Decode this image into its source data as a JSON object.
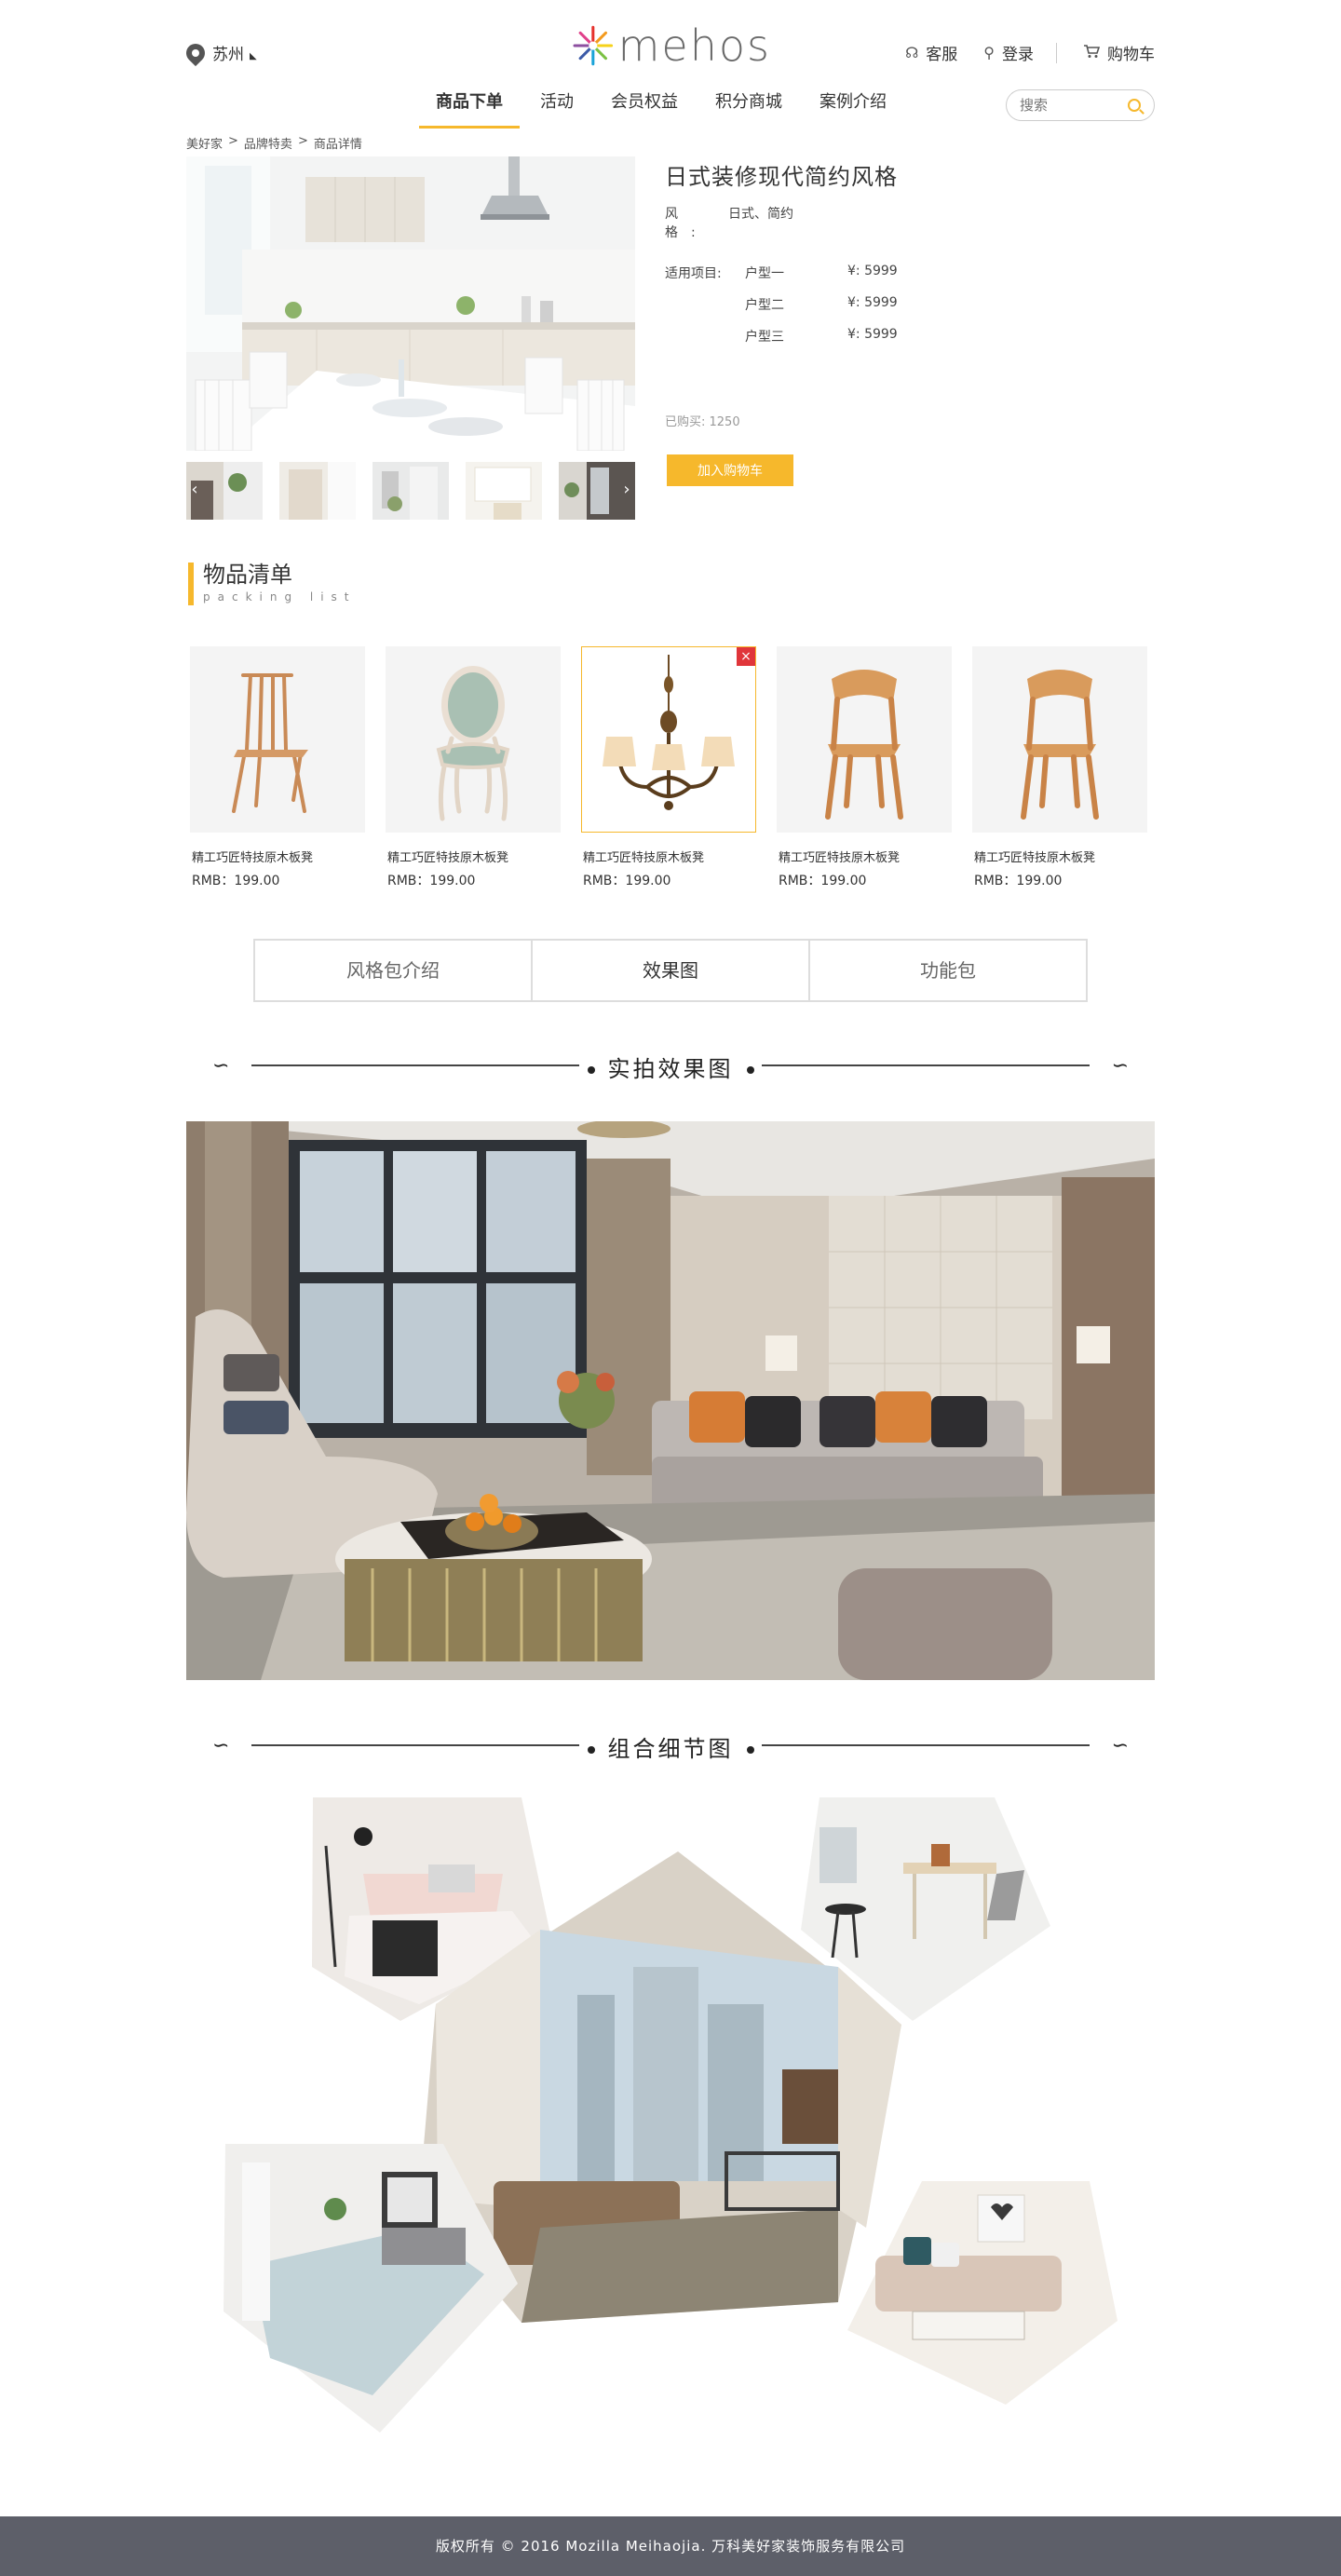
{
  "header": {
    "city": "苏州",
    "brand": "mehos",
    "service": "客服",
    "login": "登录",
    "cart": "购物车",
    "nav": [
      "商品下单",
      "活动",
      "会员权益",
      "积分商城",
      "案例介绍"
    ],
    "search_placeholder": "搜索"
  },
  "breadcrumb": [
    "美好家",
    ">",
    "品牌特卖",
    ">",
    "商品详情"
  ],
  "product": {
    "title": "日式装修现代简约风格",
    "style_label": "风格:",
    "style_value": "日式、简约",
    "types_label": "适用项目:",
    "types": [
      {
        "name": "户型一",
        "price": "¥: 5999"
      },
      {
        "name": "户型二",
        "price": "¥: 5999"
      },
      {
        "name": "户型三",
        "price": "¥: 5999"
      }
    ],
    "sold": "已购买: 1250",
    "add_to_cart": "加入购物车"
  },
  "packing": {
    "title_cn": "物品清单",
    "title_en": "packing list",
    "items": [
      {
        "name": "精工巧匠特技原木板凳",
        "price": "RMB：199.00",
        "kind": "spindle-chair"
      },
      {
        "name": "精工巧匠特技原木板凳",
        "price": "RMB：199.00",
        "kind": "upholstered-chair"
      },
      {
        "name": "精工巧匠特技原木板凳",
        "price": "RMB：199.00",
        "kind": "chandelier"
      },
      {
        "name": "精工巧匠特技原木板凳",
        "price": "RMB：199.00",
        "kind": "wood-chair"
      },
      {
        "name": "精工巧匠特技原木板凳",
        "price": "RMB：199.00",
        "kind": "wood-chair"
      }
    ]
  },
  "tabs": [
    "风格包介绍",
    "效果图",
    "功能包"
  ],
  "sections": {
    "photo_title": "实拍效果图",
    "detail_title": "组合细节图"
  },
  "footer": "版权所有 © 2016 Mozilla Meihaojia. 万科美好家装饰服务有限公司",
  "colors": {
    "accent": "#f6b82c",
    "footer_bg": "#5d5f69",
    "remove": "#e0353a"
  }
}
